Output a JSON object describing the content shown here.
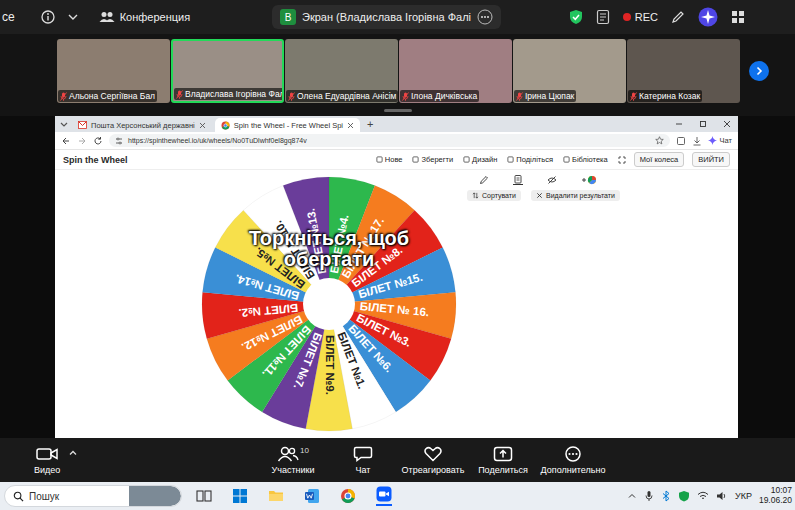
{
  "top_bar": {
    "app": "ce",
    "meeting": "Конференция",
    "share_badge": "B",
    "share_title": "Экран (Владислава Ігорівна Фалі",
    "rec": "REC"
  },
  "participants": [
    {
      "name": "Альона Сергіївна Бал",
      "speaking": false,
      "muted": true
    },
    {
      "name": "Владислава Ігорівна Фал",
      "speaking": true,
      "muted": true
    },
    {
      "name": "Олена Едуардівна Анісім",
      "speaking": false,
      "muted": true
    },
    {
      "name": "Ілона Дичківська",
      "speaking": false,
      "muted": true
    },
    {
      "name": "Ірина Цюпак",
      "speaking": false,
      "muted": true
    },
    {
      "name": "Катерина Козак",
      "speaking": false,
      "muted": true
    }
  ],
  "browser": {
    "tabs": [
      {
        "label": "Пошта Херсонський державні",
        "selected": false
      },
      {
        "label": "Spin the Wheel - Free Wheel Spi",
        "selected": true
      }
    ],
    "new_tab": "+",
    "url": "https://spinthewheel.io/uk/wheels/No0TuDlwhf0el8gq874v",
    "chat": "Чат"
  },
  "site": {
    "logo": "Spin the Wheel",
    "menu": [
      "Нове",
      "Зберегти",
      "Дизайн",
      "Поділіться",
      "Бібліотека"
    ],
    "my_wheels": "Мої колеса",
    "logout": "ВИЙТИ",
    "sort": "Сортувати",
    "clear": "Видалити результати"
  },
  "wheel": {
    "prompt": "Торкніться, щоб обертати",
    "segments": [
      {
        "label": "БІЛЕТ №4.",
        "color": "#2db84d"
      },
      {
        "label": "БІЛЕТ № 17.",
        "color": "#f57c1f"
      },
      {
        "label": "БІЛЕТ №8.",
        "color": "#e2231a"
      },
      {
        "label": "БІЛЕТ №15.",
        "color": "#3a8fd6"
      },
      {
        "label": "БІЛЕТ № 16.",
        "color": "#f57c1f"
      },
      {
        "label": "БІЛЕТ №3.",
        "color": "#e2231a"
      },
      {
        "label": "БІЛЕТ №6.",
        "color": "#3a8fd6"
      },
      {
        "label": "БІЛЕТ №1.",
        "color": "#ffffff"
      },
      {
        "label": "БІЛЕТ №9.",
        "color": "#f7e04b"
      },
      {
        "label": "БІЛЕТ №7.",
        "color": "#6a3d9a"
      },
      {
        "label": "БІЛЕТ №11.",
        "color": "#2db84d"
      },
      {
        "label": "БІЛЕТ №12.",
        "color": "#f57c1f"
      },
      {
        "label": "БІЛЕТ №2.",
        "color": "#e2231a"
      },
      {
        "label": "БІЛЕТ №14.",
        "color": "#3a8fd6"
      },
      {
        "label": "БІЛЕТ №5.",
        "color": "#f7e04b"
      },
      {
        "label": "БІЛЕТ №10.",
        "color": "#ffffff"
      },
      {
        "label": "БІЛЕТ №13.",
        "color": "#6a3d9a"
      }
    ]
  },
  "toolbar": {
    "video": "Видео",
    "participants": "Участники",
    "participants_count": "10",
    "chat": "Чат",
    "react": "Отреагировать",
    "share": "Поделиться",
    "more": "Дополнительно"
  },
  "taskbar": {
    "search": "Пошук",
    "lang": "УКР",
    "time": "10:07",
    "date": "19.06.20"
  }
}
